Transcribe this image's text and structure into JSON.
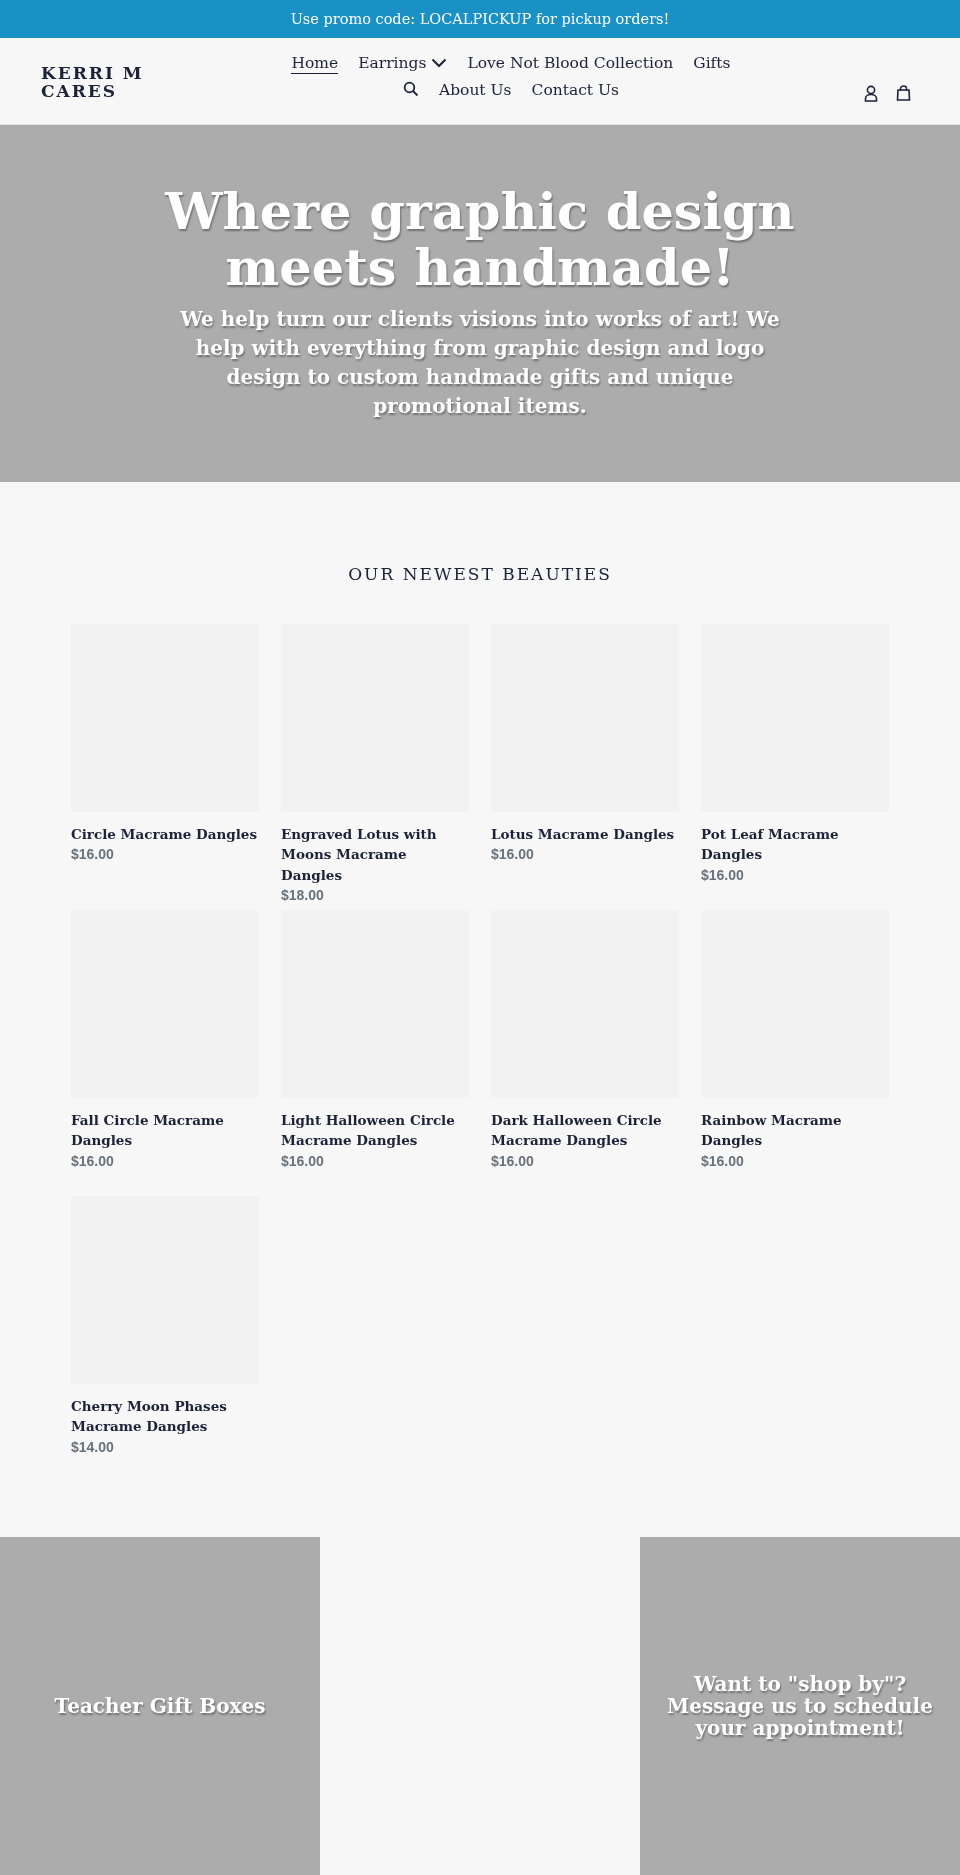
{
  "promo_bar": {
    "text": "Use promo code: LOCALPICKUP for pickup orders!"
  },
  "header": {
    "logo": "KERRI M CARES",
    "nav": [
      {
        "label": "Home",
        "selected": true,
        "has_dropdown": false
      },
      {
        "label": "Earrings",
        "selected": false,
        "has_dropdown": true
      },
      {
        "label": "Love Not Blood Collection",
        "selected": false,
        "has_dropdown": false
      },
      {
        "label": "Gifts",
        "selected": false,
        "has_dropdown": false
      },
      {
        "label": "About Us",
        "selected": false,
        "has_dropdown": false
      },
      {
        "label": "Contact Us",
        "selected": false,
        "has_dropdown": false
      }
    ]
  },
  "hero": {
    "title": "Where graphic design meets handmade!",
    "subtitle": "We help turn our clients visions into works of art! We help with everything from graphic design and logo design to custom handmade gifts and unique promotional items."
  },
  "collection": {
    "title": "OUR NEWEST BEAUTIES",
    "products": [
      {
        "name": "Circle Macrame Dangles",
        "price": "$16.00"
      },
      {
        "name": "Engraved Lotus with Moons Macrame Dangles",
        "price": "$18.00"
      },
      {
        "name": "Lotus Macrame Dangles",
        "price": "$16.00"
      },
      {
        "name": "Pot Leaf Macrame Dangles",
        "price": "$16.00"
      },
      {
        "name": "Fall Circle Macrame Dangles",
        "price": "$16.00"
      },
      {
        "name": "Light Halloween Circle Macrame Dangles",
        "price": "$16.00"
      },
      {
        "name": "Dark Halloween Circle Macrame Dangles",
        "price": "$16.00"
      },
      {
        "name": "Rainbow Macrame Dangles",
        "price": "$16.00"
      },
      {
        "name": "Cherry Moon Phases Macrame Dangles",
        "price": "$14.00"
      }
    ]
  },
  "tiles": [
    {
      "kind": "overlay",
      "title": "Teacher Gift Boxes"
    },
    {
      "kind": "empty"
    },
    {
      "kind": "overlay",
      "title": "Want to \"shop by\"? Message us to schedule your appointment!"
    }
  ]
}
